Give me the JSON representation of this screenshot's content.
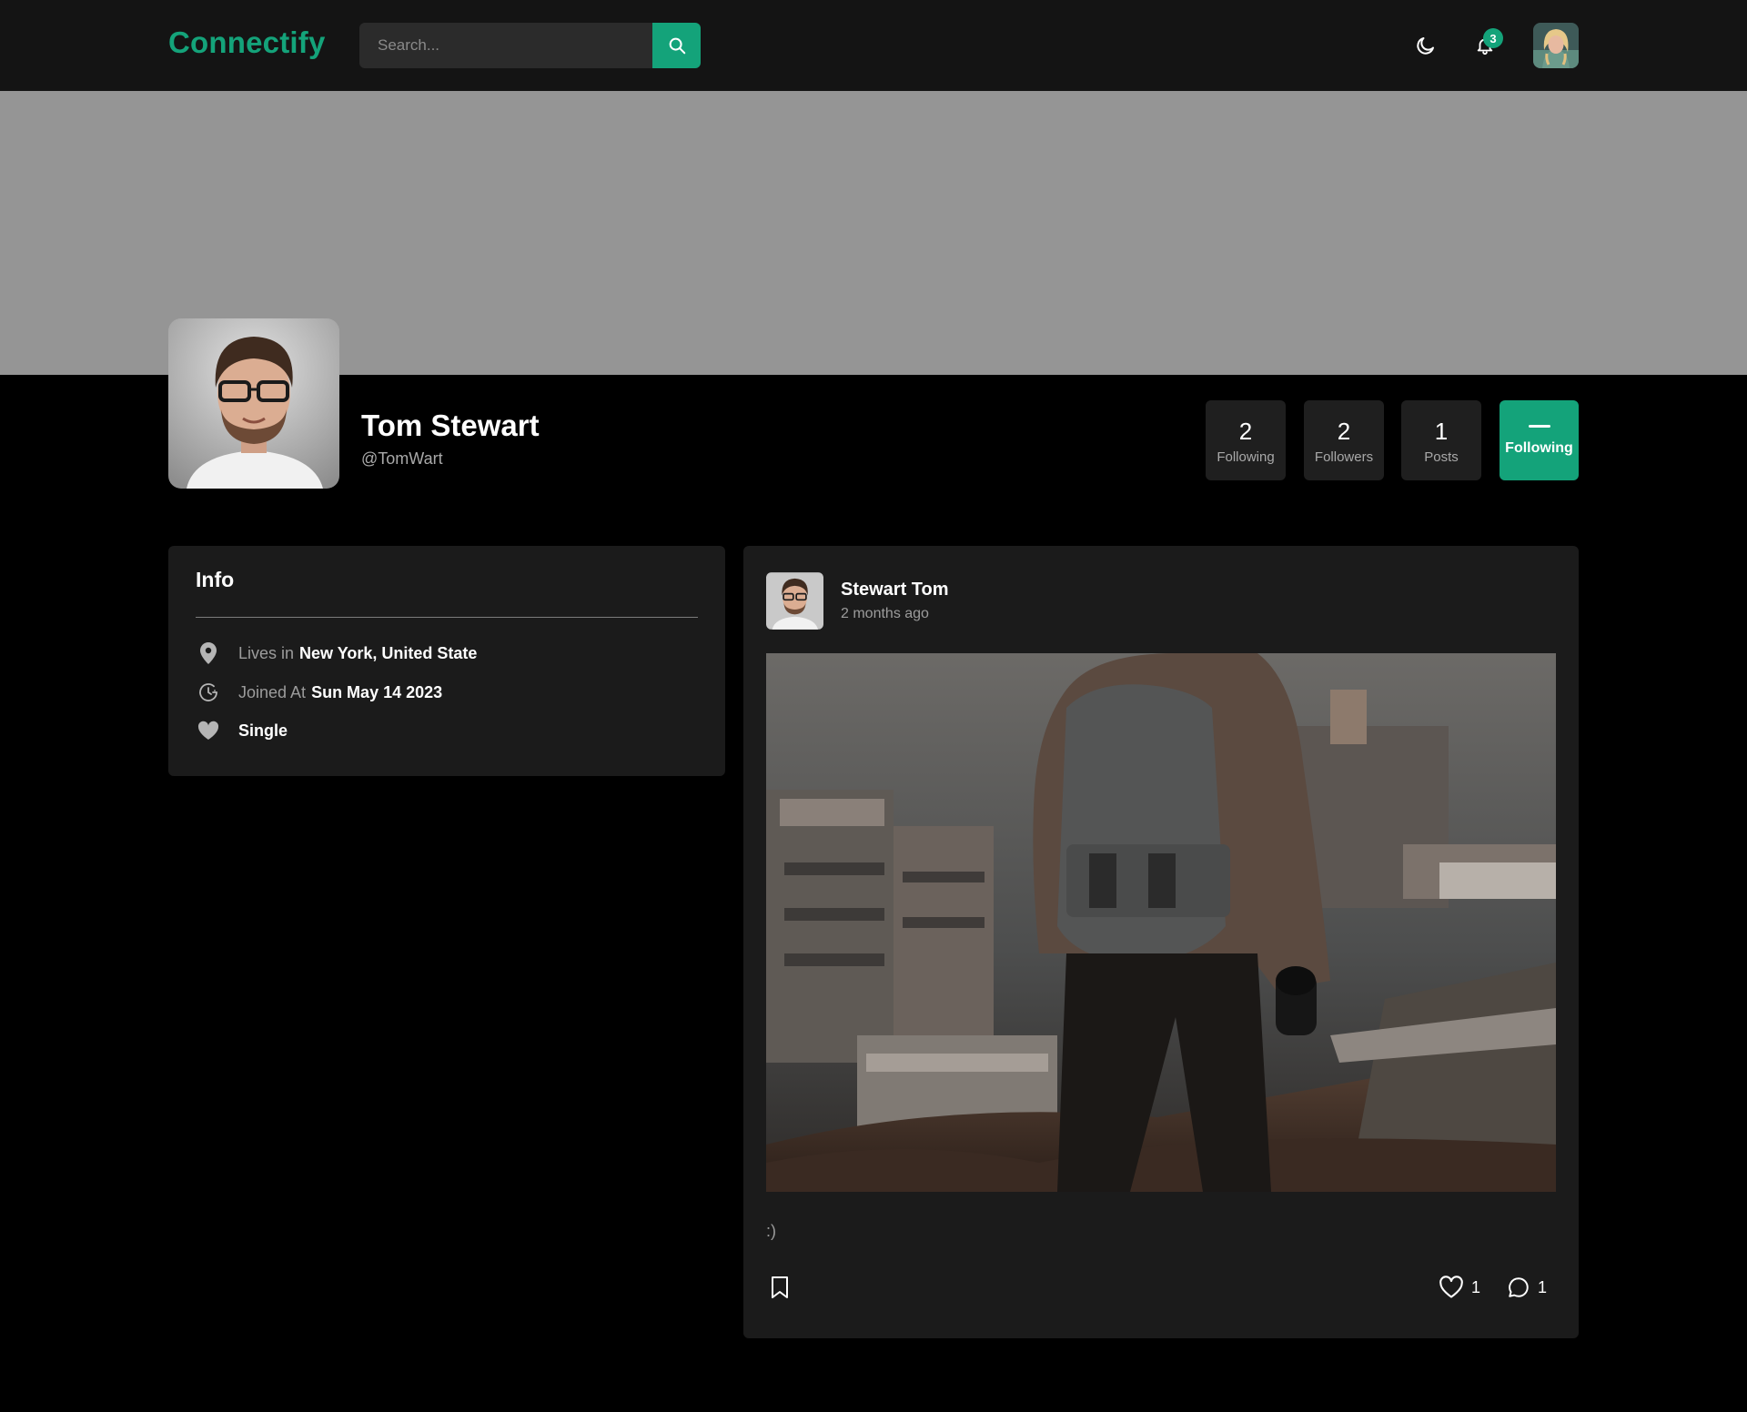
{
  "navbar": {
    "brand": "Connectify",
    "search_placeholder": "Search...",
    "notification_count": "3",
    "colors": {
      "accent": "#14a37a",
      "bar": "#141414"
    }
  },
  "profile": {
    "name": "Tom Stewart",
    "handle": "@TomWart",
    "stats": [
      {
        "count": "2",
        "label": "Following"
      },
      {
        "count": "2",
        "label": "Followers"
      },
      {
        "count": "1",
        "label": "Posts"
      }
    ],
    "follow_button_label": "Following"
  },
  "info": {
    "title": "Info",
    "lives": {
      "prefix": "Lives in",
      "value": "New York, United State"
    },
    "joined": {
      "prefix": "Joined At",
      "value": "Sun May 14 2023"
    },
    "relationship": "Single",
    "icons": [
      "location-pin-icon",
      "clock-icon",
      "heart-icon"
    ]
  },
  "post": {
    "author": "Stewart Tom",
    "time": "2 months ago",
    "text": ":)",
    "likes": "1",
    "comments": "1"
  }
}
